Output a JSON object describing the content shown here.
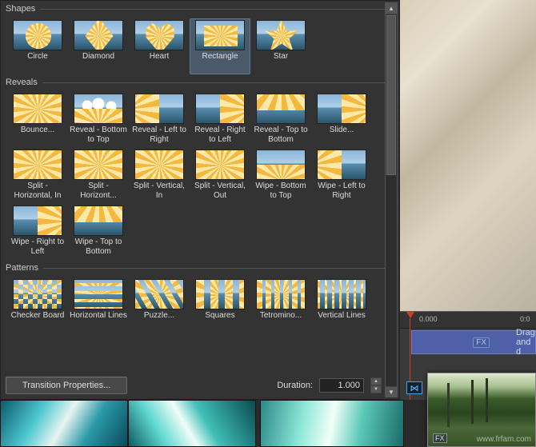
{
  "sections": {
    "shapes": {
      "title": "Shapes",
      "items": [
        {
          "label": "Circle",
          "kind": "circle",
          "selected": false
        },
        {
          "label": "Diamond",
          "kind": "diamond",
          "selected": false
        },
        {
          "label": "Heart",
          "kind": "heart",
          "selected": false
        },
        {
          "label": "Rectangle",
          "kind": "rect",
          "selected": true
        },
        {
          "label": "Star",
          "kind": "star",
          "selected": false
        }
      ]
    },
    "reveals": {
      "title": "Reveals",
      "items": [
        {
          "label": "Bounce...",
          "kind": "full"
        },
        {
          "label": "Reveal - Bottom to Top",
          "kind": "half-b",
          "cloud": true
        },
        {
          "label": "Reveal - Left to Right",
          "kind": "half-l"
        },
        {
          "label": "Reveal - Right to Left",
          "kind": "half-r"
        },
        {
          "label": "Reveal - Top to Bottom",
          "kind": "half-t"
        },
        {
          "label": "Slide...",
          "kind": "half-r"
        },
        {
          "label": "Split - Horizontal, In",
          "kind": "full"
        },
        {
          "label": "Split - Horizont...",
          "kind": "full"
        },
        {
          "label": "Split - Vertical, In",
          "kind": "full"
        },
        {
          "label": "Split - Vertical, Out",
          "kind": "full"
        },
        {
          "label": "Wipe - Bottom to Top",
          "kind": "half-b"
        },
        {
          "label": "Wipe - Left to Right",
          "kind": "half-l"
        },
        {
          "label": "Wipe - Right to Left",
          "kind": "half-r"
        },
        {
          "label": "Wipe - Top to Bottom",
          "kind": "half-t"
        }
      ]
    },
    "patterns": {
      "title": "Patterns",
      "items": [
        {
          "label": "Checker Board",
          "kind": "checker"
        },
        {
          "label": "Horizontal Lines",
          "kind": "hlines"
        },
        {
          "label": "Puzzle...",
          "kind": "puzzle"
        },
        {
          "label": "Squares",
          "kind": "squares"
        },
        {
          "label": "Tetromino...",
          "kind": "tetro"
        },
        {
          "label": "Vertical Lines",
          "kind": "vlines"
        }
      ]
    }
  },
  "footer": {
    "properties_btn": "Transition Properties...",
    "duration_label": "Duration:",
    "duration_value": "1.000"
  },
  "timeline": {
    "ticks": [
      "0.000",
      "0:0"
    ],
    "track_hint": "Drag and d",
    "fx_label": "FX"
  },
  "preview": {
    "fx_label": "FX"
  },
  "watermark": "www.frfam.com"
}
